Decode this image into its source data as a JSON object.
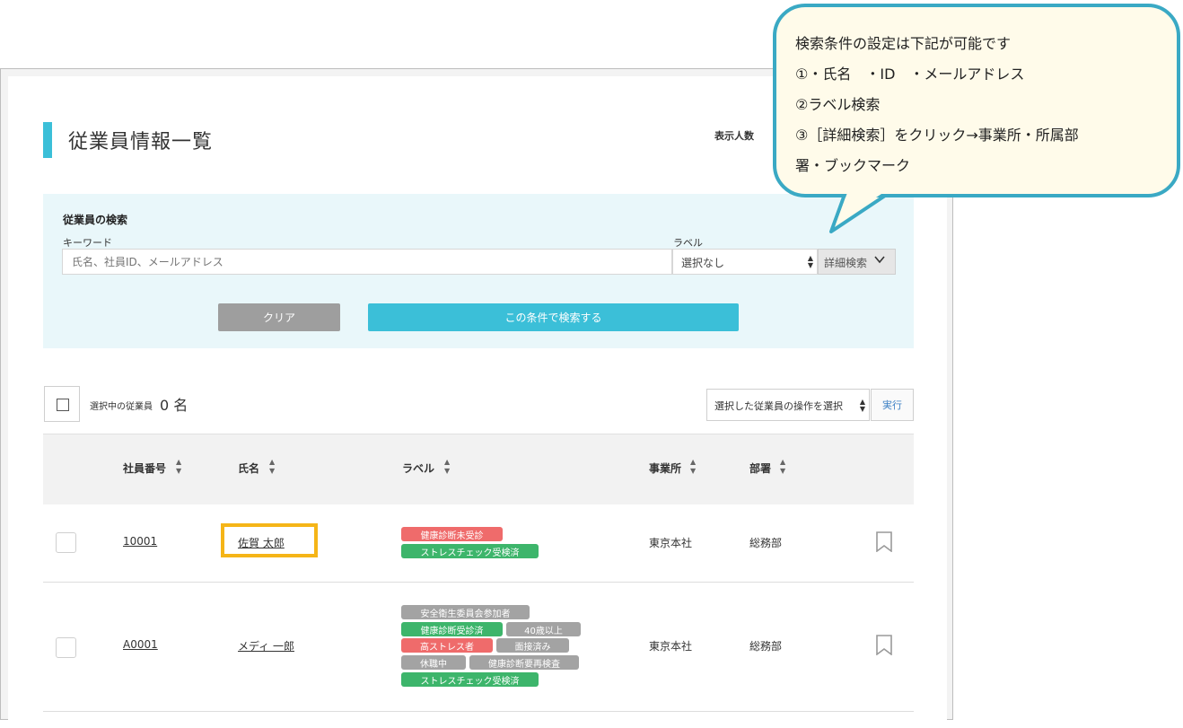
{
  "header": {
    "page_title": "従業員情報一覧",
    "display_count_label": "表示人数"
  },
  "search": {
    "title": "従業員の検索",
    "keyword_label": "キーワード",
    "keyword_placeholder": "氏名、社員ID、メールアドレス",
    "label_label": "ラベル",
    "label_value": "選択なし",
    "detail_button": "詳細検索",
    "clear_button": "クリア",
    "search_button": "この条件で検索する"
  },
  "selection": {
    "label": "選択中の従業員",
    "count": "0 名",
    "operation_placeholder": "選択した従業員の操作を選択",
    "execute_button": "実行"
  },
  "table": {
    "columns": [
      "社員番号",
      "氏名",
      "ラベル",
      "事業所",
      "部署"
    ],
    "rows": [
      {
        "id": "10001",
        "name": "佐賀 太郎",
        "labels": [
          {
            "text": "健康診断未受診",
            "color": "red"
          },
          {
            "text": "ストレスチェック受検済",
            "color": "green"
          }
        ],
        "office": "東京本社",
        "department": "総務部"
      },
      {
        "id": "A0001",
        "name": "メディ 一郎",
        "labels": [
          {
            "text": "安全衛生委員会参加者",
            "color": "gray"
          },
          {
            "text": "健康診断受診済",
            "color": "green"
          },
          {
            "text": "40歳以上",
            "color": "gray"
          },
          {
            "text": "高ストレス者",
            "color": "red"
          },
          {
            "text": "面接済み",
            "color": "gray"
          },
          {
            "text": "休職中",
            "color": "gray"
          },
          {
            "text": "健康診断要再検査",
            "color": "gray"
          },
          {
            "text": "ストレスチェック受検済",
            "color": "green"
          }
        ],
        "office": "東京本社",
        "department": "総務部"
      }
    ]
  },
  "callout": {
    "lines": [
      "検索条件の設定は下記が可能です",
      "①・氏名　・ID　・メールアドレス",
      "②ラベル検索",
      "③［詳細検索］をクリック→事業所・所属部",
      "署・ブックマーク"
    ]
  },
  "icons": {
    "sort": "sort-icon",
    "bookmark": "bookmark-icon",
    "chevron": "chevron-down-icon",
    "checkbox": "checkbox-icon"
  },
  "colors": {
    "accent": "#3bbfd8",
    "highlight": "#f5b517",
    "tag_red": "#ef6b6b",
    "tag_green": "#3db56b",
    "tag_gray": "#a3a3a3",
    "callout_border": "#3aa9c4"
  }
}
